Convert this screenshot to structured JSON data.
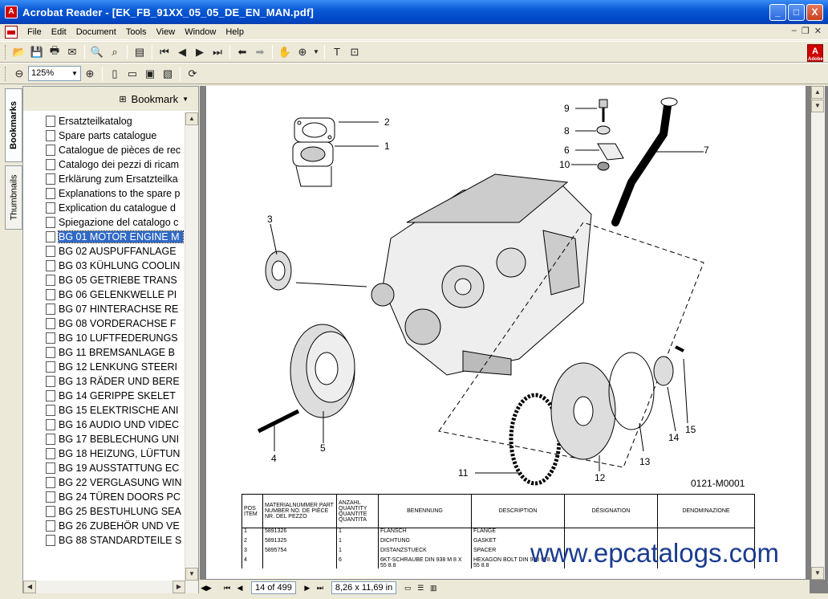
{
  "window": {
    "title": "Acrobat Reader - [EK_FB_91XX_05_05_DE_EN_MAN.pdf]",
    "buttons": [
      "_",
      "□",
      "X"
    ]
  },
  "menu": [
    "File",
    "Edit",
    "Document",
    "Tools",
    "View",
    "Window",
    "Help"
  ],
  "toolbar2": {
    "zoom_value": "125%"
  },
  "side_tabs": [
    "Bookmarks",
    "Thumbnails"
  ],
  "bookmarks": {
    "header_label": "Bookmark",
    "items": [
      "Ersatzteilkatalog",
      "Spare parts catalogue",
      "Catalogue de pièces de rec",
      "Catalogo dei pezzi di ricam",
      "Erklärung zum Ersatzteilka",
      "Explanations to the spare p",
      "Explication du catalogue d",
      "Spiegazione del catalogo c",
      "BG 01 MOTOR ENGINE M",
      "BG 02 AUSPUFFANLAGE",
      "BG 03 KÜHLUNG COOLIN",
      "BG 05 GETRIEBE TRANS",
      "BG 06 GELENKWELLE PI",
      "BG 07 HINTERACHSE RE",
      "BG 08 VORDERACHSE F",
      "BG 10 LUFTFEDERUNGS",
      "BG 11 BREMSANLAGE B",
      "BG 12 LENKUNG STEERI",
      "BG 13 RÄDER UND BERE",
      "BG 14 GERIPPE SKELET",
      "BG 15 ELEKTRISCHE ANI",
      "BG 16 AUDIO UND VIDEC",
      "BG 17 BEBLECHUNG UNI",
      "BG 18 HEIZUNG, LÜFTUN",
      "BG 19 AUSSTATTUNG EC",
      "BG 22 VERGLASUNG WIN",
      "BG 24 TÜREN DOORS PC",
      "BG 25 BESTUHLUNG SEA",
      "BG 26 ZUBEHÖR UND VE",
      "BG 88 STANDARDTEILE S"
    ],
    "selected_index": 8
  },
  "drawing": {
    "callouts": [
      "1",
      "2",
      "3",
      "4",
      "5",
      "6",
      "7",
      "8",
      "9",
      "10",
      "11",
      "12",
      "13",
      "14",
      "15"
    ],
    "catalog_code": "0121-M0001"
  },
  "parts_table": {
    "headers": [
      "POS ITEM",
      "MATERIALNUMMER PART NUMBER NO. DE PIÈCE NR. DEL PEZZO",
      "ANZAHL QUANTITY QUANTITE QUANTITA",
      "BENENNUNG",
      "DESCRIPTION",
      "DÉSIGNATION",
      "DENOMINAZIONE"
    ],
    "rows": [
      [
        "1",
        "5891326",
        "1",
        "FLANSCH",
        "FLANGE"
      ],
      [
        "2",
        "5891325",
        "1",
        "DICHTUNG",
        "GASKET"
      ],
      [
        "3",
        "5895754",
        "1",
        "DISTANZSTUECK",
        "SPACER"
      ],
      [
        "4",
        "",
        "6",
        "6KT-SCHRAUBE DIN 938 M 8 X 55 8.8",
        "HEXAGON BOLT DIN 938 M 8 X 55 8.8"
      ]
    ]
  },
  "watermark": "www.epcatalogs.com",
  "status_bar": {
    "page_info": "14 of 499",
    "page_size": "8,26 x 11,69 in"
  }
}
